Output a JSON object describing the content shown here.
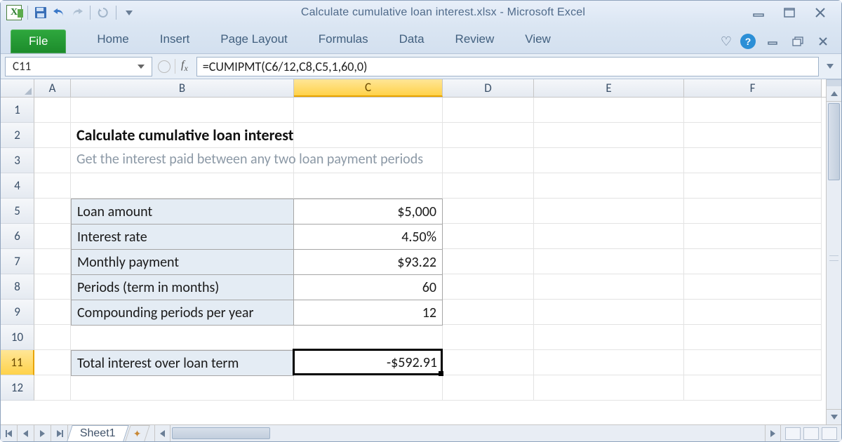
{
  "app": {
    "title": "Calculate cumulative loan interest.xlsx  -  Microsoft Excel"
  },
  "ribbon": {
    "file": "File",
    "tabs": [
      "Home",
      "Insert",
      "Page Layout",
      "Formulas",
      "Data",
      "Review",
      "View"
    ]
  },
  "namebox": "C11",
  "formula": "=CUMIPMT(C6/12,C8,C5,1,60,0)",
  "columns": [
    "A",
    "B",
    "C",
    "D",
    "E",
    "F"
  ],
  "active_column": "C",
  "active_row": 11,
  "rows_visible": [
    1,
    2,
    3,
    4,
    5,
    6,
    7,
    8,
    9,
    10,
    11,
    12
  ],
  "content": {
    "title": "Calculate cumulative loan interest",
    "subtitle": "Get the interest paid between any two loan payment periods",
    "table": [
      {
        "label": "Loan amount",
        "value": "$5,000"
      },
      {
        "label": "Interest rate",
        "value": "4.50%"
      },
      {
        "label": "Monthly payment",
        "value": "$93.22"
      },
      {
        "label": "Periods (term in months)",
        "value": "60"
      },
      {
        "label": "Compounding periods per year",
        "value": "12"
      }
    ],
    "result_label": "Total interest over loan term",
    "result_value": "-$592.91"
  },
  "sheet_tab": "Sheet1",
  "chart_data": {
    "type": "table",
    "title": "Calculate cumulative loan interest",
    "rows": [
      [
        "Loan amount",
        "$5,000"
      ],
      [
        "Interest rate",
        "4.50%"
      ],
      [
        "Monthly payment",
        "$93.22"
      ],
      [
        "Periods (term in months)",
        "60"
      ],
      [
        "Compounding periods per year",
        "12"
      ],
      [
        "Total interest over loan term",
        "-$592.91"
      ]
    ]
  }
}
